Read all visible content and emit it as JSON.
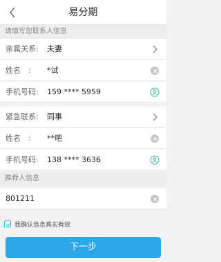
{
  "nav": {
    "title": "易分期"
  },
  "contacts_section": {
    "header": "请填写您联系人信息"
  },
  "relative": {
    "relation_label": "亲属关系:",
    "relation_value": "夫妻",
    "name_label": "姓名　:",
    "name_value": "*试",
    "phone_label": "手机号码:",
    "phone_value": "159 **** 5959"
  },
  "emergency": {
    "relation_label": "紧急联系:",
    "relation_value": "同事",
    "name_label": "姓名　:",
    "name_value": "**吧",
    "phone_label": "手机号码:",
    "phone_value": "138 **** 3636"
  },
  "referrer_section": {
    "header": "推荐人信息",
    "value": "801211"
  },
  "confirm": {
    "text": "我确认信息真实有效",
    "checked": true
  },
  "next_button": {
    "label": "下一步"
  },
  "colors": {
    "accent": "#2aa7e6"
  }
}
